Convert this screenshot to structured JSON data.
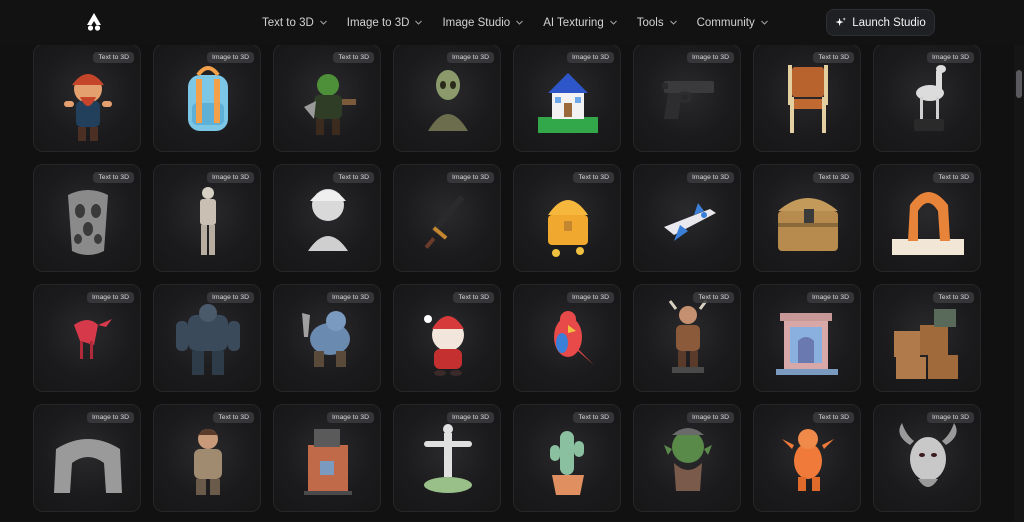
{
  "nav": {
    "items": [
      "Text to 3D",
      "Image to 3D",
      "Image Studio",
      "AI Texturing",
      "Tools",
      "Community"
    ],
    "launch_label": "Launch Studio"
  },
  "gallery": {
    "cards": [
      {
        "badge": "Text to 3D",
        "model": "dwarf-pirate"
      },
      {
        "badge": "Image to 3D",
        "model": "backpack"
      },
      {
        "badge": "Text to 3D",
        "model": "orc-warrior"
      },
      {
        "badge": "Image to 3D",
        "model": "alien-bust"
      },
      {
        "badge": "Image to 3D",
        "model": "house"
      },
      {
        "badge": "Image to 3D",
        "model": "pistol"
      },
      {
        "badge": "Text to 3D",
        "model": "chair"
      },
      {
        "badge": "Image to 3D",
        "model": "horse-statue"
      },
      {
        "badge": "Text to 3D",
        "model": "vase"
      },
      {
        "badge": "Image to 3D",
        "model": "man-figure"
      },
      {
        "badge": "Text to 3D",
        "model": "einstein-bust"
      },
      {
        "badge": "Image to 3D",
        "model": "sword"
      },
      {
        "badge": "Text to 3D",
        "model": "treasure-chest"
      },
      {
        "badge": "Image to 3D",
        "model": "spaceship"
      },
      {
        "badge": "Text to 3D",
        "model": "wooden-chest"
      },
      {
        "badge": "Text to 3D",
        "model": "rock-arch"
      },
      {
        "badge": "Image to 3D",
        "model": "raptor"
      },
      {
        "badge": "Image to 3D",
        "model": "stone-golem"
      },
      {
        "badge": "Image to 3D",
        "model": "rhino-warrior"
      },
      {
        "badge": "Text to 3D",
        "model": "santa-creature"
      },
      {
        "badge": "Image to 3D",
        "model": "parrot"
      },
      {
        "badge": "Text to 3D",
        "model": "viking"
      },
      {
        "badge": "Image to 3D",
        "model": "castle-tower"
      },
      {
        "badge": "Text to 3D",
        "model": "crates"
      },
      {
        "badge": "Image to 3D",
        "model": "stone-gate"
      },
      {
        "badge": "Text to 3D",
        "model": "boy-figure"
      },
      {
        "badge": "Image to 3D",
        "model": "tower-house"
      },
      {
        "badge": "Image to 3D",
        "model": "christ-statue"
      },
      {
        "badge": "Text to 3D",
        "model": "cactus"
      },
      {
        "badge": "Image to 3D",
        "model": "orc-bust"
      },
      {
        "badge": "Text to 3D",
        "model": "dragon"
      },
      {
        "badge": "Image to 3D",
        "model": "demon-head"
      }
    ]
  }
}
